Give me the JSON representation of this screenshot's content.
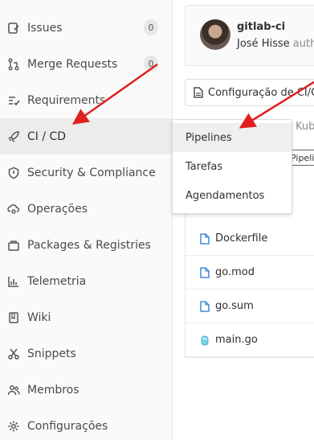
{
  "sidebar": {
    "items": [
      {
        "label": "Issues",
        "icon": "issues-icon",
        "badge": "0"
      },
      {
        "label": "Merge Requests",
        "icon": "merge-request-icon",
        "badge": "0"
      },
      {
        "label": "Requirements",
        "icon": "requirements-icon"
      },
      {
        "label": "CI / CD",
        "icon": "rocket-icon",
        "active": true
      },
      {
        "label": "Security & Compliance",
        "icon": "shield-icon"
      },
      {
        "label": "Operações",
        "icon": "cloud-gear-icon"
      },
      {
        "label": "Packages & Registries",
        "icon": "package-icon"
      },
      {
        "label": "Telemetria",
        "icon": "chart-icon"
      },
      {
        "label": "Wiki",
        "icon": "book-icon"
      },
      {
        "label": "Snippets",
        "icon": "scissors-icon"
      },
      {
        "label": "Membros",
        "icon": "users-icon"
      },
      {
        "label": "Configurações",
        "icon": "settings-icon"
      }
    ]
  },
  "dropdown": {
    "items": [
      {
        "label": "Pipelines",
        "active": true
      },
      {
        "label": "Tarefas"
      },
      {
        "label": "Agendamentos"
      }
    ]
  },
  "commit": {
    "title": "gitlab-ci",
    "author": "José Hisse",
    "author_suffix": "auth"
  },
  "file_button": {
    "label": "Configuração de CI/CD"
  },
  "kube_label": "Kub",
  "tooltip": "Pipelines",
  "files": [
    {
      "name": "Dockerfile",
      "icon": "file-icon"
    },
    {
      "name": "go.mod",
      "icon": "file-icon"
    },
    {
      "name": "go.sum",
      "icon": "file-icon"
    },
    {
      "name": "main.go",
      "icon": "go-file-icon"
    }
  ],
  "colors": {
    "arrow": "#e02020",
    "sidebar_bg": "#fafafa",
    "active_bg": "#ececec",
    "file_icon": "#1f78d1"
  }
}
